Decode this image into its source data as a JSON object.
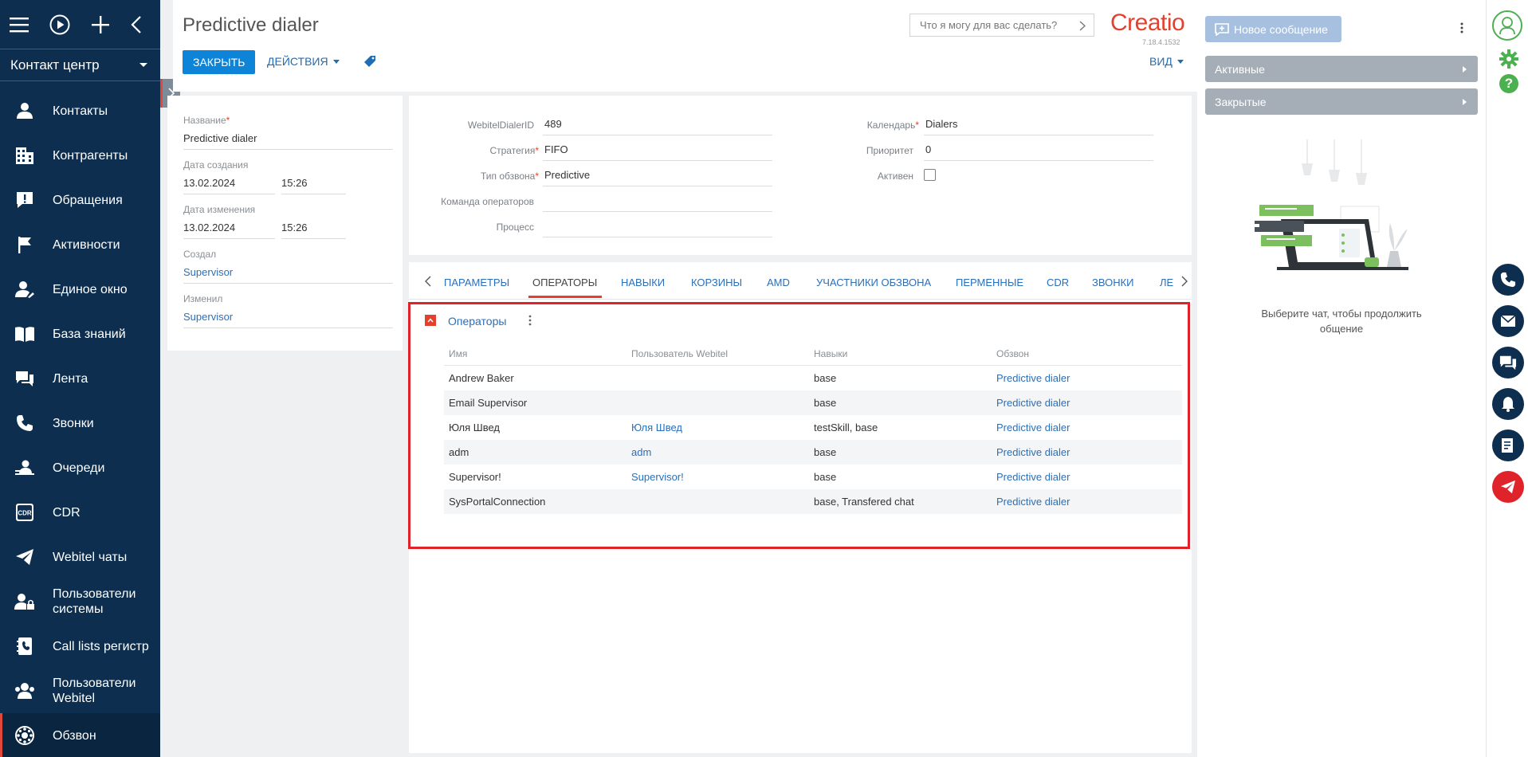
{
  "sidebar": {
    "workspace": "Контакт центр",
    "items": [
      {
        "label": "Контакты",
        "icon": "person-icon"
      },
      {
        "label": "Контрагенты",
        "icon": "building-icon"
      },
      {
        "label": "Обращения",
        "icon": "alert-note-icon"
      },
      {
        "label": "Активности",
        "icon": "flag-icon"
      },
      {
        "label": "Единое окно",
        "icon": "person-edit-icon"
      },
      {
        "label": "База знаний",
        "icon": "book-icon"
      },
      {
        "label": "Лента",
        "icon": "feed-icon"
      },
      {
        "label": "Звонки",
        "icon": "phone-icon"
      },
      {
        "label": "Очереди",
        "icon": "queue-icon"
      },
      {
        "label": "CDR",
        "icon": "cdr-icon"
      },
      {
        "label": "Webitel чаты",
        "icon": "send-icon"
      },
      {
        "label": "Пользователи системы",
        "icon": "user-lock-icon"
      },
      {
        "label": "Call lists регистр",
        "icon": "contact-book-icon"
      },
      {
        "label": "Пользователи Webitel",
        "icon": "users-icon"
      },
      {
        "label": "Обзвон",
        "icon": "dialer-icon"
      }
    ]
  },
  "header": {
    "title": "Predictive dialer",
    "close_label": "ЗАКРЫТЬ",
    "actions_label": "ДЕЙСТВИЯ",
    "search_placeholder": "Что я могу для вас сделать?",
    "logo": "Creatio",
    "version": "7.18.4.1532",
    "view_label": "ВИД"
  },
  "info": {
    "name_label": "Название",
    "name_value": "Predictive dialer",
    "created_label": "Дата создания",
    "created_date": "13.02.2024",
    "created_time": "15:26",
    "modified_label": "Дата изменения",
    "modified_date": "13.02.2024",
    "modified_time": "15:26",
    "created_by_label": "Создал",
    "created_by": "Supervisor",
    "modified_by_label": "Изменил",
    "modified_by": "Supervisor"
  },
  "fields": {
    "dialer_id_label": "WebitelDialerID",
    "dialer_id": "489",
    "strategy_label": "Стратегия",
    "strategy": "FIFO",
    "type_label": "Тип обзвона",
    "type": "Predictive",
    "team_label": "Команда операторов",
    "team": "",
    "process_label": "Процесс",
    "process": "",
    "calendar_label": "Календарь",
    "calendar": "Dialers",
    "priority_label": "Приоритет",
    "priority": "0",
    "active_label": "Активен",
    "active": false
  },
  "tabs": [
    {
      "label": "ПАРАМЕТРЫ",
      "active": false
    },
    {
      "label": "ОПЕРАТОРЫ",
      "active": true
    },
    {
      "label": "НАВЫКИ",
      "active": false
    },
    {
      "label": "КОРЗИНЫ",
      "active": false
    },
    {
      "label": "AMD",
      "active": false
    },
    {
      "label": "УЧАСТНИКИ ОБЗВОНА",
      "active": false
    },
    {
      "label": "ПЕРМЕННЫЕ",
      "active": false
    },
    {
      "label": "CDR",
      "active": false
    },
    {
      "label": "ЗВОНКИ",
      "active": false
    },
    {
      "label": "ЛЕ",
      "active": false
    }
  ],
  "operators": {
    "title": "Операторы",
    "columns": [
      "Имя",
      "Пользователь Webitel",
      "Навыки",
      "Обзвон"
    ],
    "rows": [
      [
        "Andrew Baker",
        "",
        "base",
        "Predictive dialer"
      ],
      [
        "Email Supervisor",
        "",
        "base",
        "Predictive dialer"
      ],
      [
        "Юля Швед",
        "Юля Швед",
        "testSkill, base",
        "Predictive dialer"
      ],
      [
        "adm",
        "adm",
        "base",
        "Predictive dialer"
      ],
      [
        "Supervisor!",
        "Supervisor!",
        "base",
        "Predictive dialer"
      ],
      [
        "SysPortalConnection",
        "",
        "base, Transfered chat",
        "Predictive dialer"
      ]
    ]
  },
  "chat": {
    "new_message_label": "Новое сообщение",
    "active_label": "Активные",
    "closed_label": "Закрытые",
    "hint": "Выберите чат, чтобы продолжить общение"
  },
  "colors": {
    "sidebar": "#0d2e4e",
    "accent": "#e3412d",
    "link": "#2a6fba",
    "primary_button": "#0e84d8"
  }
}
